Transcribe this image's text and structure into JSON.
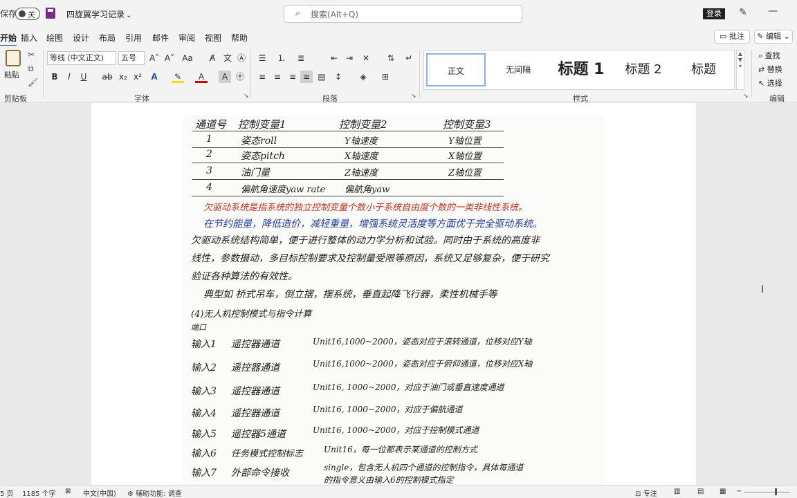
{
  "titlebar": {
    "autosave_label": "保存",
    "autosave_state": "关",
    "doc_name": "四旋翼学习记录",
    "search_placeholder": "搜索(Alt+Q)",
    "login_label": "登录",
    "minimize_glyph": "—"
  },
  "tabs": [
    "开始",
    "插入",
    "绘图",
    "设计",
    "布局",
    "引用",
    "邮件",
    "审阅",
    "视图",
    "帮助"
  ],
  "active_tab": "开始",
  "tab_actions": {
    "comment": "批注",
    "edit": "编辑"
  },
  "ribbon": {
    "clipboard": {
      "paste": "粘贴",
      "group": "剪贴板"
    },
    "font": {
      "font_name": "等线 (中文正文)",
      "font_size": "五号",
      "group": "字体",
      "buttons": [
        "B",
        "I",
        "U",
        "ab",
        "x₂",
        "x²",
        "A",
        "A",
        "A"
      ]
    },
    "paragraph": {
      "group": "段落"
    },
    "styles": {
      "group": "样式",
      "items": [
        "正文",
        "无间隔",
        "标题 1",
        "标题 2",
        "标题"
      ],
      "selected": "正文"
    },
    "editing": {
      "group": "编辑",
      "find": "查找",
      "replace": "替换",
      "select": "选择"
    }
  },
  "document": {
    "table_header": [
      "通道号",
      "控制变量1",
      "控制变量2",
      "控制变量3"
    ],
    "table_rows": [
      [
        "1",
        "姿态roll",
        "Y轴速度",
        "Y轴位置"
      ],
      [
        "2",
        "姿态pitch",
        "X轴速度",
        "X轴位置"
      ],
      [
        "3",
        "油门量",
        "Z轴速度",
        "Z轴位置"
      ],
      [
        "4",
        "偏航角速度yaw rate",
        "偏航角yaw",
        ""
      ]
    ],
    "red_line": "欠驱动系统是指系统的独立控制变量个数小于系统自由度个数的一类非线性系统。",
    "blue_line": "在节约能量，降低造价，减轻重量，增强系统灵活度等方面优于完全驱动系统。",
    "para_lines": [
      "欠驱动系统结构简单，便于进行整体的动力学分析和试验。同时由于系统的高度非",
      "线性，参数摄动，多目标控制要求及控制量受限等原因，系统又足够复杂，便于研究",
      "验证各种算法的有效性。",
      "典型如 桥式吊车，倒立摆，摆系统，垂直起降飞行器，柔性机械手等"
    ],
    "section_title": "(4)无人机控制模式与指令计算",
    "port_label": "端口",
    "inputs": [
      {
        "name": "输入1",
        "desc": "遥控器通道",
        "detail": "Unit16,1000~2000，姿态对应于滚转通道，位移对应Y轴"
      },
      {
        "name": "输入2",
        "desc": "遥控器通道",
        "detail": "Unit16,1000~2000，姿态对应于俯仰通道，位移对应X轴"
      },
      {
        "name": "输入3",
        "desc": "遥控器通道",
        "detail": "Unit16, 1000~2000，对应于油门或垂直速度通道"
      },
      {
        "name": "输入4",
        "desc": "遥控器通道",
        "detail": "Unit16, 1000~2000，对应于偏航通道"
      },
      {
        "name": "输入5",
        "desc": "遥控器5通道",
        "detail": "Unit16, 1000~2000，对应于控制模式通道"
      },
      {
        "name": "输入6",
        "desc": "任务模式控制标志",
        "detail": "Unit16，每一位都表示某通道的控制方式"
      },
      {
        "name": "输入7",
        "desc": "外部命令接收",
        "detail": "single，包含无人机四个通道的控制指令，具体每通道"
      }
    ],
    "last_line": "的指令意义由输入6的控制模式指定"
  },
  "statusbar": {
    "page": "5 页",
    "words": "1185 个字",
    "language": "中文(中国)",
    "accessibility": "辅助功能: 调查",
    "focus": "专注"
  }
}
